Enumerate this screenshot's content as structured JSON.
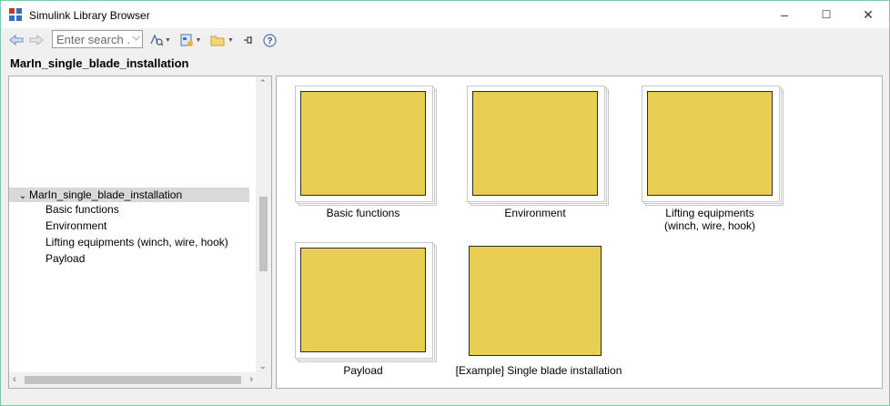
{
  "window": {
    "title": "Simulink Library Browser",
    "controls": {
      "minimize": "–",
      "maximize": "☐",
      "close": "✕"
    }
  },
  "toolbar": {
    "back_icon": "arrow-left-icon",
    "forward_icon": "arrow-right-icon",
    "search": {
      "placeholder": "Enter search ...",
      "value": ""
    },
    "icons": [
      "find-icon",
      "new-model-icon",
      "open-folder-icon",
      "pin-icon",
      "help-icon"
    ]
  },
  "library_title": "MarIn_single_blade_installation",
  "tree": {
    "root": {
      "label": "MarIn_single_blade_installation",
      "expanded": true
    },
    "children": [
      "Basic functions",
      "Environment",
      "Lifting equipments (winch, wire, hook)",
      "Payload"
    ]
  },
  "blocks": [
    {
      "label": "Basic functions"
    },
    {
      "label": "Environment"
    },
    {
      "label_line1": "Lifting equipments",
      "label_line2": "(winch, wire, hook)"
    },
    {
      "label": "Payload"
    },
    {
      "label": "[Example] Single blade installation"
    }
  ],
  "colors": {
    "block_fill": "#e8ce52",
    "selection": "#d9d9d9",
    "window_border": "#7ec8a9"
  }
}
